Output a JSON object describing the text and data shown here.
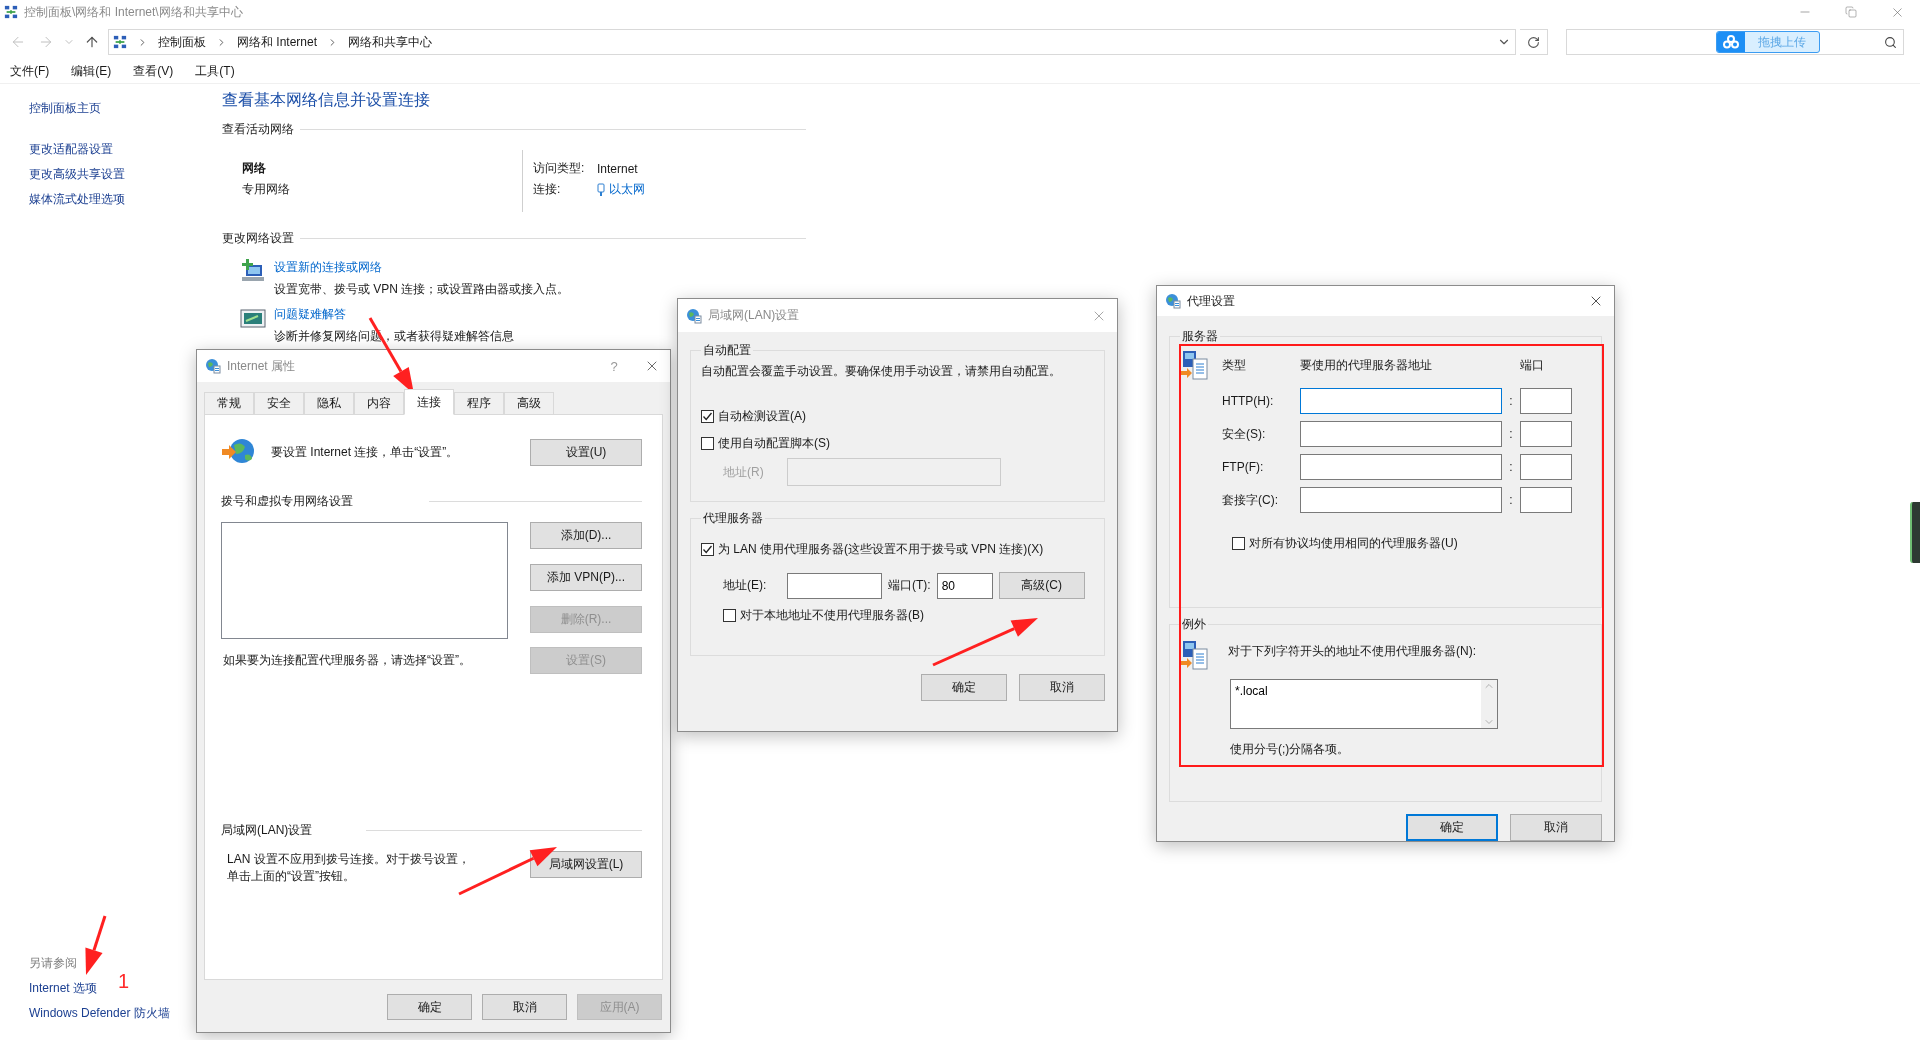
{
  "window": {
    "title": "控制面板\\网络和 Internet\\网络和共享中心"
  },
  "address_bar": {
    "breadcrumbs": [
      "控制面板",
      "网络和 Internet",
      "网络和共享中心"
    ]
  },
  "search": {
    "upload_badge": "拖拽上传"
  },
  "menu": [
    "文件(F)",
    "编辑(E)",
    "查看(V)",
    "工具(T)"
  ],
  "sidebar": {
    "items": [
      "控制面板主页",
      "更改适配器设置",
      "更改高级共享设置",
      "媒体流式处理选项"
    ],
    "see_also": {
      "heading": "另请参阅",
      "links": [
        "Internet 选项",
        "Windows Defender 防火墙"
      ]
    }
  },
  "main": {
    "heading": "查看基本网络信息并设置连接",
    "active_networks": {
      "heading": "查看活动网络",
      "network_name": "网络",
      "network_type": "专用网络",
      "access_type_label": "访问类型:",
      "access_type": "Internet",
      "connection_label": "连接:",
      "connection": "以太网"
    },
    "change_settings": {
      "heading": "更改网络设置",
      "tasks": [
        {
          "kind": "setup",
          "link": "设置新的连接或网络",
          "description": "设置宽带、拨号或 VPN 连接；或设置路由器或接入点。"
        },
        {
          "kind": "troubleshoot",
          "link": "问题疑难解答",
          "description": "诊断并修复网络问题，或者获得疑难解答信息"
        }
      ]
    }
  },
  "internet_properties": {
    "title": "Internet 属性",
    "help": "?",
    "tabs": [
      {
        "label": "常规",
        "selected": false
      },
      {
        "label": "安全",
        "selected": false
      },
      {
        "label": "隐私",
        "selected": false
      },
      {
        "label": "内容",
        "selected": false
      },
      {
        "label": "连接",
        "selected": true
      },
      {
        "label": "程序",
        "selected": false
      },
      {
        "label": "高级",
        "selected": false
      }
    ],
    "setup_text": "要设置 Internet 连接，单击“设置”。",
    "setup_button": "设置(U)",
    "dialup_heading": "拨号和虚拟专用网络设置",
    "list_buttons": [
      {
        "label": "添加(D)...",
        "disabled": false
      },
      {
        "label": "添加 VPN(P)...",
        "disabled": false
      },
      {
        "label": "删除(R)...",
        "disabled": true
      }
    ],
    "proxy_hint": "如果要为连接配置代理服务器，请选择“设置”。",
    "proxy_button": {
      "label": "设置(S)",
      "disabled": true
    },
    "lan_heading": "局域网(LAN)设置",
    "lan_text": "LAN 设置不应用到拨号连接。对于拨号设置，单击上面的“设置”按钮。",
    "lan_button": "局域网设置(L)",
    "footer_buttons": [
      {
        "label": "确定",
        "disabled": false
      },
      {
        "label": "取消",
        "disabled": false
      },
      {
        "label": "应用(A)",
        "disabled": true
      }
    ]
  },
  "lan_settings": {
    "title": "局域网(LAN)设置",
    "auto_config": {
      "heading": "自动配置",
      "note": "自动配置会覆盖手动设置。要确保使用手动设置，请禁用自动配置。",
      "options": [
        {
          "label": "自动检测设置(A)",
          "checked": true
        },
        {
          "label": "使用自动配置脚本(S)",
          "checked": false
        }
      ],
      "address": {
        "label": "地址(R)",
        "disabled": true
      }
    },
    "proxy": {
      "heading": "代理服务器",
      "use_proxy": {
        "label": "为 LAN 使用代理服务器(这些设置不用于拨号或 VPN 连接)(X)",
        "checked": true
      },
      "address_label": "地址(E):",
      "port_label": "端口(T):",
      "port": "80",
      "advanced_button": "高级(C)",
      "bypass_local": {
        "label": "对于本地地址不使用代理服务器(B)",
        "checked": false
      }
    },
    "buttons": [
      "确定",
      "取消"
    ]
  },
  "proxy_settings": {
    "title": "代理设置",
    "servers": {
      "heading": "服务器",
      "columns": [
        "类型",
        "要使用的代理服务器地址",
        "端口"
      ],
      "rows": [
        {
          "label": "HTTP(H):",
          "separator": ":",
          "focused": true
        },
        {
          "label": "安全(S):",
          "separator": ":",
          "focused": false
        },
        {
          "label": "FTP(F):",
          "separator": ":",
          "focused": false
        },
        {
          "label": "套接字(C):",
          "separator": ":",
          "focused": false
        }
      ],
      "same_for_all": {
        "label": "对所有协议均使用相同的代理服务器(U)",
        "checked": false
      }
    },
    "exceptions": {
      "heading": "例外",
      "label": "对于下列字符开头的地址不使用代理服务器(N):",
      "value": "*.local",
      "hint": "使用分号(;)分隔各项。"
    },
    "buttons": [
      {
        "label": "确定",
        "default": true
      },
      {
        "label": "取消",
        "default": false
      }
    ]
  },
  "annotations": {
    "step_number": "1"
  }
}
